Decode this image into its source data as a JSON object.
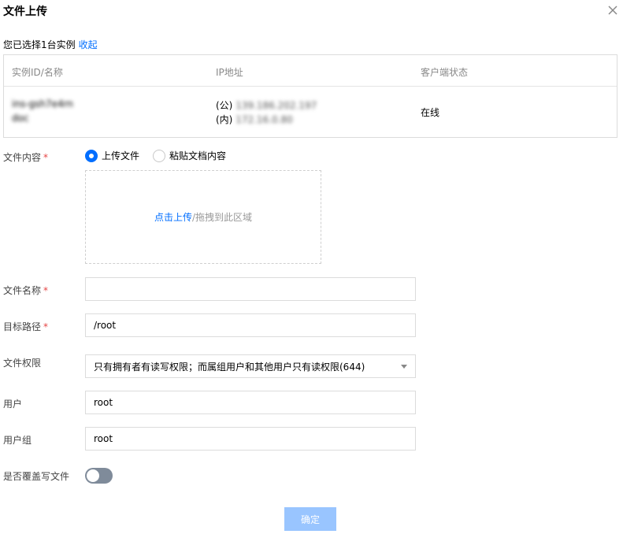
{
  "dialog": {
    "title": "文件上传"
  },
  "selection": {
    "text": "您已选择1台实例",
    "collapse_label": "收起"
  },
  "table": {
    "columns": [
      "实例ID/名称",
      "IP地址",
      "客户端状态"
    ],
    "rows": [
      {
        "instance_id": "ins-gsh7e4rn",
        "instance_name": "doc",
        "public_ip_prefix": "(公)",
        "public_ip": "139.186.202.197",
        "private_ip_prefix": "(内)",
        "private_ip": "172.16.0.80",
        "status": "在线"
      }
    ]
  },
  "form": {
    "content_label": "文件内容",
    "radio_upload": "上传文件",
    "radio_paste": "粘贴文档内容",
    "upload_link": "点击上传",
    "upload_hint": "/拖拽到此区域",
    "filename_label": "文件名称",
    "filename_value": "",
    "target_path_label": "目标路径",
    "target_path_value": "/root",
    "permission_label": "文件权限",
    "permission_value": "只有拥有者有读写权限；而属组用户和其他用户只有读权限(644)",
    "user_label": "用户",
    "user_value": "root",
    "group_label": "用户组",
    "group_value": "root",
    "overwrite_label": "是否覆盖写文件",
    "overwrite_enabled": false,
    "required_mark": "*"
  },
  "actions": {
    "confirm_label": "确定"
  },
  "colors": {
    "accent": "#006eff",
    "required": "#e54545",
    "disabled_button": "#99c5ff",
    "toggle_off": "#7f8b9a"
  }
}
